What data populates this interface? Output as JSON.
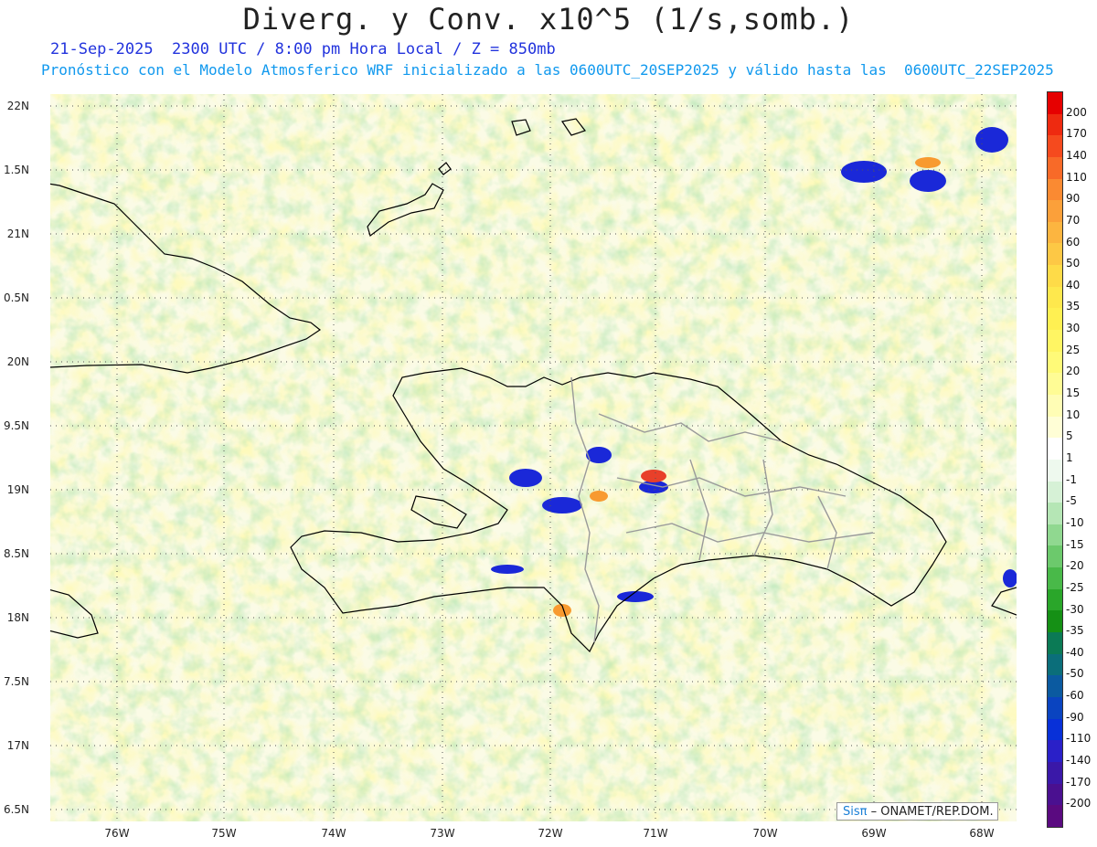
{
  "title": "Diverg. y Conv. x10^5 (1/s,somb.)",
  "subtitle_time": "21-Sep-2025  2300 UTC / 8:00 pm Hora Local / Z = 850mb",
  "subtitle_model": "Pronóstico con el Modelo Atmosferico WRF inicializado a las 0600UTC_20SEP2025 y válido hasta las  0600UTC_22SEP2025",
  "lat_labels": [
    "22N",
    "1.5N",
    "21N",
    "0.5N",
    "20N",
    "9.5N",
    "19N",
    "8.5N",
    "18N",
    "7.5N",
    "17N",
    "6.5N"
  ],
  "lon_labels": [
    "76W",
    "75W",
    "74W",
    "73W",
    "72W",
    "71W",
    "70W",
    "69W",
    "68W"
  ],
  "colorbar": {
    "labels": [
      "200",
      "170",
      "140",
      "110",
      "90",
      "70",
      "60",
      "50",
      "40",
      "35",
      "30",
      "25",
      "20",
      "15",
      "10",
      "5",
      "1",
      "-1",
      "-5",
      "-10",
      "-15",
      "-20",
      "-25",
      "-30",
      "-35",
      "-40",
      "-50",
      "-60",
      "-90",
      "-110",
      "-140",
      "-170",
      "-200"
    ],
    "colors": [
      "#e60000",
      "#ee2a10",
      "#f54a1e",
      "#f86a28",
      "#fa8a32",
      "#fba03a",
      "#fcb540",
      "#fdc845",
      "#fedb48",
      "#fee84d",
      "#fff052",
      "#fff563",
      "#fffa78",
      "#fffc95",
      "#fffdb5",
      "#fffed6",
      "#ffffff",
      "#eef9ee",
      "#d6f1d6",
      "#b5e6b5",
      "#90d890",
      "#6cc96c",
      "#49b949",
      "#2aa62a",
      "#159015",
      "#0b7a55",
      "#0b6e7a",
      "#0b5aa0",
      "#0a44c0",
      "#0830d8",
      "#2a20c8",
      "#3a18a8",
      "#4a1090",
      "#5a0a80"
    ]
  },
  "credit_logo": "Sisπ",
  "credit_text": "– ONAMET/REP.DOM."
}
